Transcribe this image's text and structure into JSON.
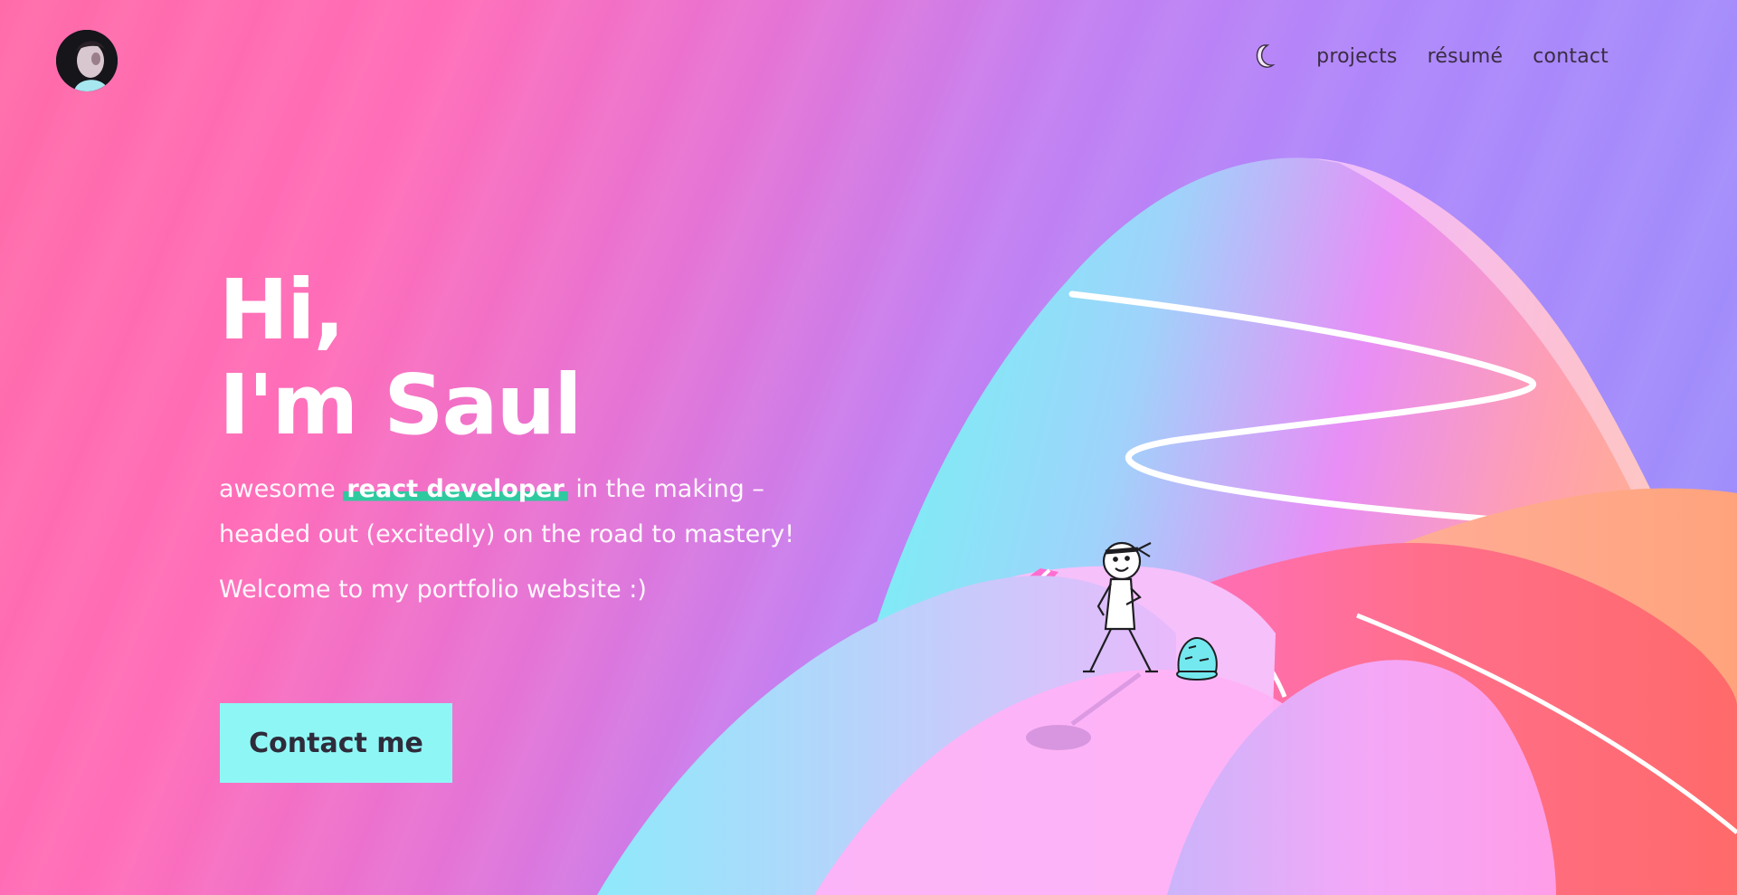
{
  "header": {
    "avatar_alt": "Saul avatar",
    "nav": {
      "theme_toggle_icon": "moon-icon",
      "links": [
        "projects",
        "résumé",
        "contact"
      ]
    }
  },
  "hero": {
    "greeting_line1": "Hi,",
    "greeting_line2": "I'm Saul",
    "tagline_prefix": "awesome",
    "tagline_highlight": "react developer",
    "tagline_suffix": "in the making –",
    "tagline_line2": "headed out (excitedly) on the road to mastery!",
    "welcome": "Welcome to my portfolio website :)",
    "cta_label": "Contact me"
  },
  "colors": {
    "background_start": "#ff6aa8",
    "background_end": "#9a90fb",
    "cta_background": "#8ef7f5",
    "highlight": "#2fc9a0",
    "nav_text": "#3b2d43"
  }
}
